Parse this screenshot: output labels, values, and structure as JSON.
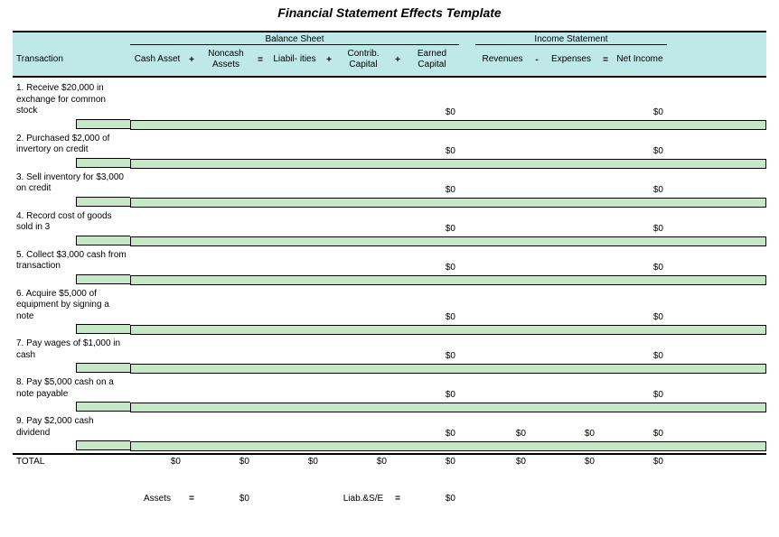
{
  "title": "Financial Statement Effects Template",
  "sections": {
    "balance": "Balance Sheet",
    "income": "Income Statement"
  },
  "headers": {
    "transaction": "Transaction",
    "cash_asset": "Cash Asset",
    "noncash_assets": "Noncash Assets",
    "liabilities": "Liabil- ities",
    "contrib_capital": "Contrib. Capital",
    "earned_capital": "Earned Capital",
    "revenues": "Revenues",
    "expenses": "Expenses",
    "net_income": "Net Income"
  },
  "ops": {
    "plus": "+",
    "equals": "=",
    "minus": "-"
  },
  "rows": [
    {
      "txn": "1. Receive $20,000 in exchange for common stock",
      "earned": "$0",
      "net": "$0"
    },
    {
      "txn": "2. Purchased $2,000 of invertory on credit",
      "earned": "$0",
      "net": "$0"
    },
    {
      "txn": "3. Sell inventory for $3,000 on credit",
      "earned": "$0",
      "net": "$0"
    },
    {
      "txn": "4. Record cost of goods sold in 3",
      "earned": "$0",
      "net": "$0"
    },
    {
      "txn": "5. Collect $3,000 cash from transaction",
      "earned": "$0",
      "net": "$0"
    },
    {
      "txn": "6. Acquire $5,000 of equipment by signing a note",
      "earned": "$0",
      "net": "$0"
    },
    {
      "txn": "7. Pay wages of $1,000 in cash",
      "earned": "$0",
      "net": "$0"
    },
    {
      "txn": "8. Pay $5,000 cash on a note payable",
      "earned": "$0",
      "net": "$0"
    },
    {
      "txn": "9. Pay $2,000 cash dividend",
      "earned": "$0",
      "rev": "$0",
      "exp": "$0",
      "net": "$0"
    }
  ],
  "total": {
    "label": "TOTAL",
    "cash": "$0",
    "noncash": "$0",
    "liab": "$0",
    "contrib": "$0",
    "earned": "$0",
    "rev": "$0",
    "exp": "$0",
    "net": "$0"
  },
  "equation": {
    "assets": "Assets",
    "eq": "=",
    "assets_val": "$0",
    "liabse": "Liab.&S/E",
    "liabse_val": "$0"
  }
}
